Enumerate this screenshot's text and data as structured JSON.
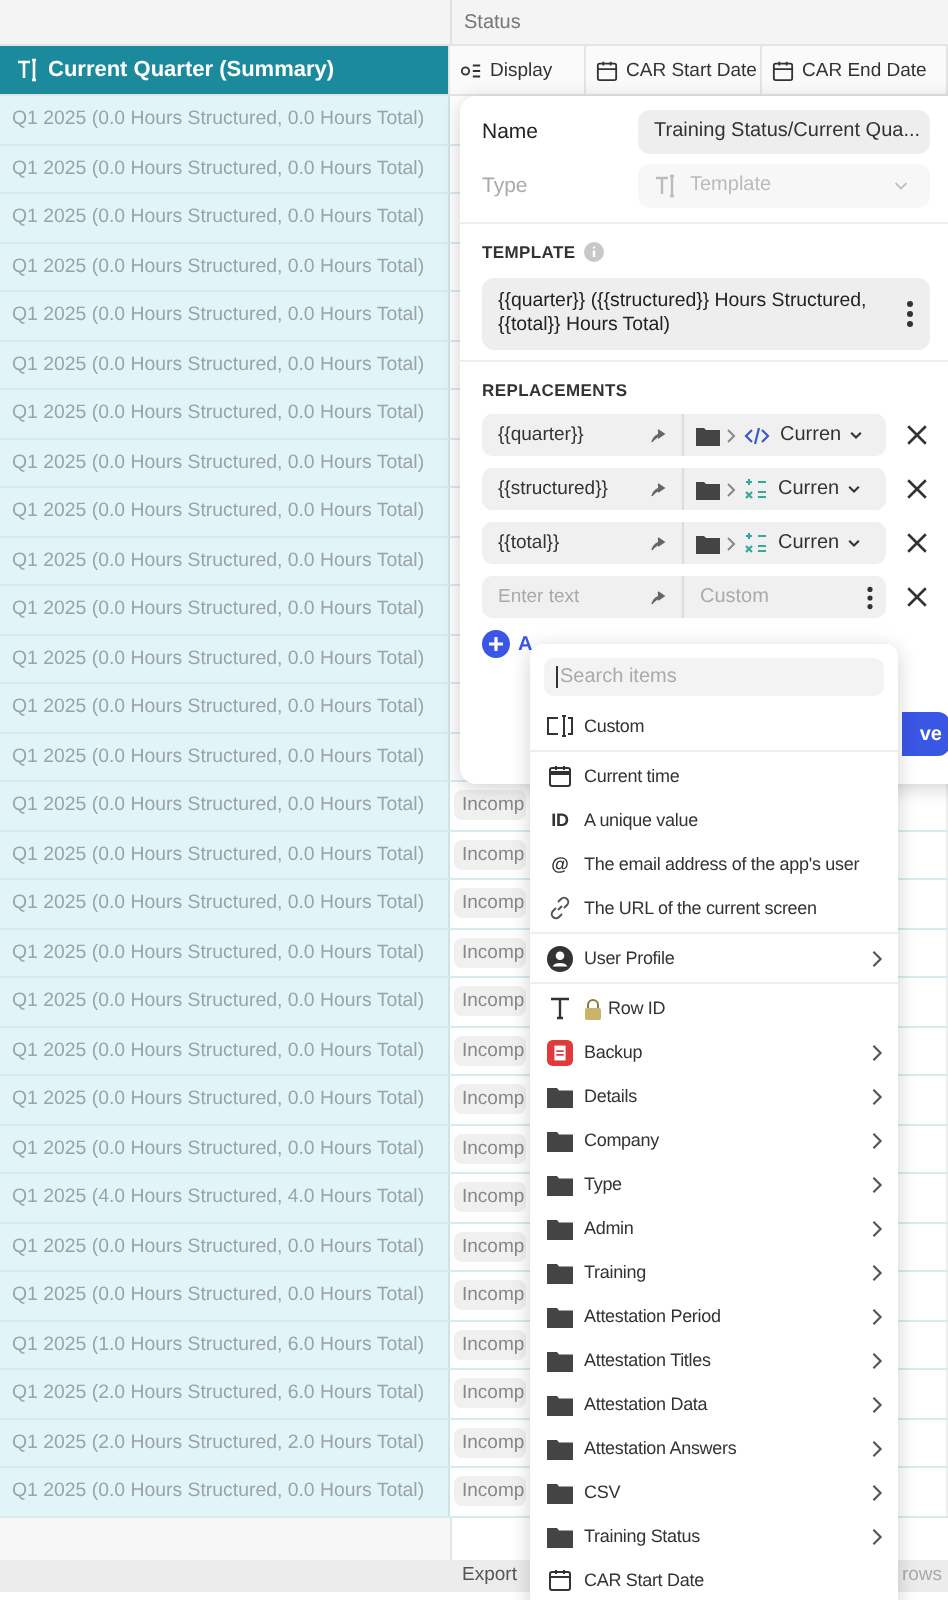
{
  "table": {
    "group_header": "Status",
    "columns": [
      {
        "label": "Current Quarter (Summary)",
        "kind": "text",
        "selected": true
      },
      {
        "label": "Display",
        "kind": "choice",
        "selected": false
      },
      {
        "label": "CAR Start Date",
        "kind": "date",
        "selected": false
      },
      {
        "label": "CAR End Date",
        "kind": "date",
        "selected": false
      }
    ],
    "rows": [
      {
        "quarter": "Q1 2025 (0.0 Hours Structured, 0.0 Hours Total)"
      },
      {
        "quarter": "Q1 2025 (0.0 Hours Structured, 0.0 Hours Total)"
      },
      {
        "quarter": "Q1 2025 (0.0 Hours Structured, 0.0 Hours Total)"
      },
      {
        "quarter": "Q1 2025 (0.0 Hours Structured, 0.0 Hours Total)"
      },
      {
        "quarter": "Q1 2025 (0.0 Hours Structured, 0.0 Hours Total)"
      },
      {
        "quarter": "Q1 2025 (0.0 Hours Structured, 0.0 Hours Total)"
      },
      {
        "quarter": "Q1 2025 (0.0 Hours Structured, 0.0 Hours Total)"
      },
      {
        "quarter": "Q1 2025 (0.0 Hours Structured, 0.0 Hours Total)"
      },
      {
        "quarter": "Q1 2025 (0.0 Hours Structured, 0.0 Hours Total)"
      },
      {
        "quarter": "Q1 2025 (0.0 Hours Structured, 0.0 Hours Total)"
      },
      {
        "quarter": "Q1 2025 (0.0 Hours Structured, 0.0 Hours Total)"
      },
      {
        "quarter": "Q1 2025 (0.0 Hours Structured, 0.0 Hours Total)"
      },
      {
        "quarter": "Q1 2025 (0.0 Hours Structured, 0.0 Hours Total)"
      },
      {
        "quarter": "Q1 2025 (0.0 Hours Structured, 0.0 Hours Total)"
      },
      {
        "quarter": "Q1 2025 (0.0 Hours Structured, 0.0 Hours Total)",
        "status": "Incomp"
      },
      {
        "quarter": "Q1 2025 (0.0 Hours Structured, 0.0 Hours Total)",
        "status": "Incomp"
      },
      {
        "quarter": "Q1 2025 (0.0 Hours Structured, 0.0 Hours Total)",
        "status": "Incomp"
      },
      {
        "quarter": "Q1 2025 (0.0 Hours Structured, 0.0 Hours Total)",
        "status": "Incomp"
      },
      {
        "quarter": "Q1 2025 (0.0 Hours Structured, 0.0 Hours Total)",
        "status": "Incomp"
      },
      {
        "quarter": "Q1 2025 (0.0 Hours Structured, 0.0 Hours Total)",
        "status": "Incomp"
      },
      {
        "quarter": "Q1 2025 (0.0 Hours Structured, 0.0 Hours Total)",
        "status": "Incomp"
      },
      {
        "quarter": "Q1 2025 (0.0 Hours Structured, 0.0 Hours Total)",
        "status": "Incomp"
      },
      {
        "quarter": "Q1 2025 (4.0 Hours Structured, 4.0 Hours Total)",
        "status": "Incomp"
      },
      {
        "quarter": "Q1 2025 (0.0 Hours Structured, 0.0 Hours Total)",
        "status": "Incomp"
      },
      {
        "quarter": "Q1 2025 (0.0 Hours Structured, 0.0 Hours Total)",
        "status": "Incomp"
      },
      {
        "quarter": "Q1 2025 (1.0 Hours Structured, 6.0 Hours Total)",
        "status": "Incomp"
      },
      {
        "quarter": "Q1 2025 (2.0 Hours Structured, 6.0 Hours Total)",
        "status": "Incomp"
      },
      {
        "quarter": "Q1 2025 (2.0 Hours Structured, 2.0 Hours Total)",
        "status": "Incomp"
      },
      {
        "quarter": "Q1 2025 (0.0 Hours Structured, 0.0 Hours Total)",
        "status": "Incomp"
      }
    ]
  },
  "footer": {
    "export": "Export",
    "rows": "rows"
  },
  "editor": {
    "name_label": "Name",
    "name_value": "Training Status/Current Qua...",
    "type_label": "Type",
    "type_value": "Template",
    "type_disabled": true,
    "template_label": "TEMPLATE",
    "template": "{{quarter}} ({{structured}} Hours Structured, {{total}} Hours Total)",
    "replacements_label": "REPLACEMENTS",
    "replacements": [
      {
        "kind": "column",
        "key": "{{quarter}}",
        "source": {
          "kind": "code",
          "label": "Curren"
        }
      },
      {
        "kind": "column",
        "key": "{{structured}}",
        "source": {
          "kind": "number",
          "label": "Curren"
        }
      },
      {
        "kind": "column",
        "key": "{{total}}",
        "source": {
          "kind": "number",
          "label": "Curren"
        }
      },
      {
        "kind": "custom",
        "key_placeholder": "Enter text",
        "source_placeholder": "Custom"
      }
    ],
    "add_label": "A",
    "save_label": "ve"
  },
  "menu": {
    "search_placeholder": "Search items",
    "sections": [
      [
        {
          "kind": "custom",
          "label": "Custom",
          "submenu": false
        }
      ],
      [
        {
          "kind": "time",
          "label": "Current time",
          "submenu": false
        },
        {
          "kind": "glyph",
          "glyph": "ID",
          "label": "A unique value",
          "submenu": false
        },
        {
          "kind": "glyph",
          "glyph": "@",
          "label": "The email address of the app's user",
          "submenu": false
        },
        {
          "kind": "link",
          "label": "The URL of the current screen",
          "submenu": false
        }
      ],
      [
        {
          "kind": "profile",
          "label": "User Profile",
          "submenu": true
        }
      ],
      [
        {
          "kind": "text",
          "label": "Row ID",
          "locked": true,
          "submenu": false
        },
        {
          "kind": "table",
          "label": "Backup",
          "submenu": true
        },
        {
          "kind": "folder",
          "label": "Details",
          "submenu": true
        },
        {
          "kind": "folder",
          "label": "Company",
          "submenu": true
        },
        {
          "kind": "folder",
          "label": "Type",
          "submenu": true
        },
        {
          "kind": "folder",
          "label": "Admin",
          "submenu": true
        },
        {
          "kind": "folder",
          "label": "Training",
          "submenu": true
        },
        {
          "kind": "folder",
          "label": "Attestation Period",
          "submenu": true
        },
        {
          "kind": "folder",
          "label": "Attestation Titles",
          "submenu": true
        },
        {
          "kind": "folder",
          "label": "Attestation Data",
          "submenu": true
        },
        {
          "kind": "folder",
          "label": "Attestation Answers",
          "submenu": true
        },
        {
          "kind": "folder",
          "label": "CSV",
          "submenu": true
        },
        {
          "kind": "folder",
          "label": "Training Status",
          "submenu": true
        },
        {
          "kind": "date",
          "label": "CAR Start Date",
          "submenu": false
        }
      ]
    ]
  }
}
